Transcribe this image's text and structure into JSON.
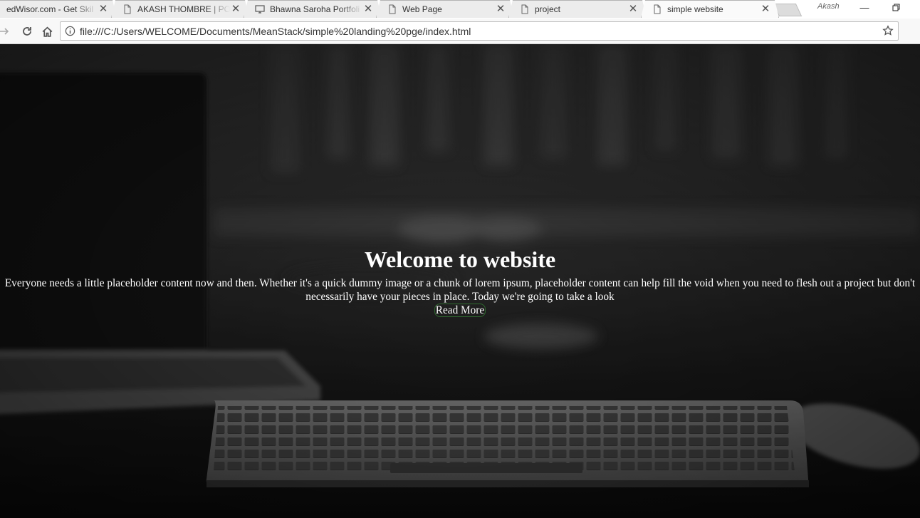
{
  "browser": {
    "tabs": [
      {
        "title": "edWisor.com - Get Skil",
        "icon": "no-favicon",
        "active": false
      },
      {
        "title": "AKASH THOMBRE | PO",
        "icon": "page-icon",
        "active": false
      },
      {
        "title": "Bhawna Saroha Portfoli",
        "icon": "monitor-icon",
        "active": false
      },
      {
        "title": "Web Page",
        "icon": "page-icon",
        "active": false
      },
      {
        "title": "project",
        "icon": "page-icon",
        "active": false
      },
      {
        "title": "simple website",
        "icon": "page-icon",
        "active": true
      }
    ],
    "profile_name": "Akash",
    "address": "file:///C:/Users/WELCOME/Documents/MeanStack/simple%20landing%20pge/index.html"
  },
  "page": {
    "heading": "Welcome to website",
    "paragraph": "Everyone needs a little placeholder content now and then. Whether it's a quick dummy image or a chunk of lorem ipsum, placeholder content can help fill the void when you need to flesh out a project but don't necessarily have your pieces in place. Today we're going to take a look",
    "read_more_label": "Read More"
  },
  "colors": {
    "page_background": "#242424",
    "text": "#ffffff",
    "read_more_border": "#2f6b2f"
  }
}
